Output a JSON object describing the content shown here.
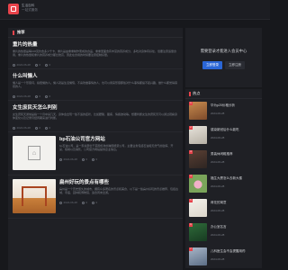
{
  "header": {
    "site_name_line1": "生活百科",
    "site_name_line2": "一站式服务"
  },
  "main": {
    "section_title": "推荐",
    "articles": [
      {
        "title": "重片的热量",
        "excerpt": "重片的热量是每100克约含多少千卡，重片是由重重制作而成的食品，重重里面含有丰富的营养成分，多吃对身体有好处，但要注意适量食用，重片的热量和重片的营养成分都比较高，因此在食用的时候要注意控制好量。",
        "date": "2024-06-28",
        "views": "0",
        "comments": "0"
      },
      {
        "title": "什么叫懒人",
        "excerpt": "懒人是一个形容词，指很懒的人。懒人就是生活懒惰，不喜欢做事情的人，也可以用来形容那些对什么事情都提不起兴趣，做什么都觉得麻烦的人。",
        "date": "2024-06-28",
        "views": "0",
        "comments": "0"
      },
      {
        "title": "女生庶民天怎么判别",
        "excerpt": "女生庶民天通常是指一个月中某几天，身体会出现一些不适的症状，比如腰酸、腹痛、情绪波动等。想要判断女生的庶民天可以通过观察身体变化以及记录月经周期来进行判断。",
        "date": "2024-06-28",
        "views": "0",
        "comments": "0"
      },
      {
        "title": "bp石油公司官方网站",
        "excerpt": "bp石油公司，是一家总部位于英国伦敦的跨国能源公司，主要业务包括石油和天然气的勘探、开采、炼制以及销售，公司官方网站提供企业信息。",
        "date": "2024-06-28",
        "views": "0",
        "comments": "0"
      },
      {
        "title": "扁州好玩的景点有哪些",
        "excerpt": "扁州是一个历史悠久的城市，拥有众多著名的景点和美食，以下是一些扁州好玩的景点推荐，包括古城、寺庙、园林和博物馆，适合周末出游。",
        "date": "2024-06-28",
        "views": "0",
        "comments": "0"
      }
    ]
  },
  "sidebar": {
    "login_prompt": "需要登录才能进入会员中心",
    "login_button": "立即登录",
    "register_button": "立即注册",
    "hot_title": "热点",
    "hot_items": [
      {
        "rank": "1",
        "title": "华为p20价格分析",
        "date": "2024-06-28"
      },
      {
        "rank": "2",
        "title": "感染新冠后什么能吃",
        "date": "2024-06-28"
      },
      {
        "rank": "3",
        "title": "男装休闲鞋推荐",
        "date": "2024-06-28"
      },
      {
        "rank": "4",
        "title": "福生大厦怎么去新大楼",
        "date": "2024-06-28"
      },
      {
        "rank": "5",
        "title": "荷花的寓意",
        "date": "2024-06-28"
      },
      {
        "rank": "6",
        "title": "办公室名言",
        "date": "2024-06-28"
      },
      {
        "rank": "7",
        "title": "儿科医生会不会提醒用药",
        "date": "2024-06-28"
      }
    ]
  },
  "colors": {
    "background": "#17181c",
    "panel": "#1f2025",
    "accent": "#e8434b",
    "button_primary": "#2a66d6"
  }
}
